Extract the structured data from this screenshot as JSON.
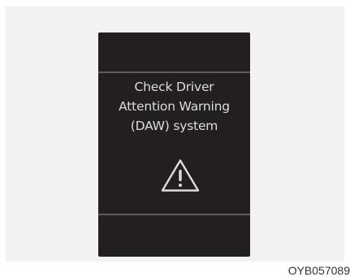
{
  "display": {
    "message": [
      "Check Driver",
      "Attention Warning",
      "(DAW) system"
    ],
    "icon": "warning-triangle-icon",
    "colors": {
      "screen": "#231f20",
      "text": "#dcdcdc",
      "divider": "#5e5b5b"
    }
  },
  "figure": {
    "code": "OYB057089"
  }
}
